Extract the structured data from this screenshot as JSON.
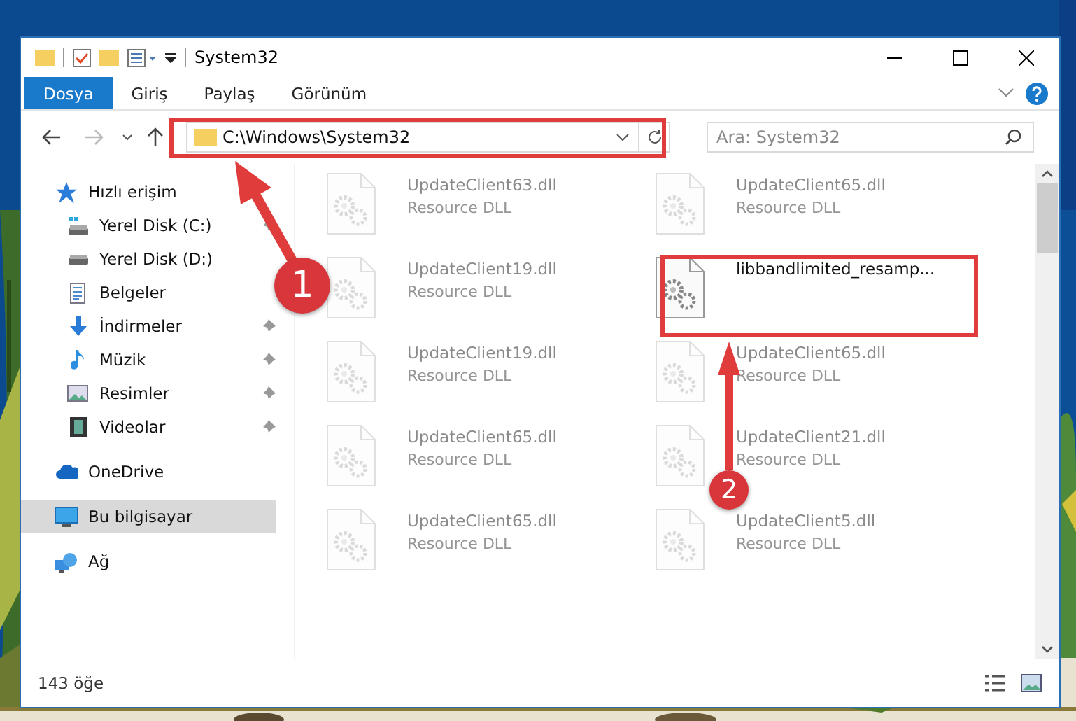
{
  "window": {
    "title": "System32"
  },
  "ribbon_tabs": [
    {
      "label": "Dosya",
      "kind": "file",
      "selected": false
    },
    {
      "label": "Giriş",
      "kind": "tab",
      "selected": false
    },
    {
      "label": "Paylaş",
      "kind": "tab",
      "selected": false
    },
    {
      "label": "Görünüm",
      "kind": "tab",
      "selected": false
    }
  ],
  "address_bar": {
    "value": "C:\\Windows\\System32"
  },
  "search": {
    "placeholder": "Ara: System32"
  },
  "sidebar": {
    "items": [
      {
        "label": "Hızlı erişim",
        "selected": false,
        "children": [
          {
            "label": "Yerel Disk (C:)",
            "pinned": true,
            "selected": false
          },
          {
            "label": "Yerel Disk (D:)",
            "pinned": false,
            "selected": false
          },
          {
            "label": "Belgeler",
            "pinned": false,
            "selected": false
          },
          {
            "label": "İndirmeler",
            "pinned": true,
            "selected": false
          },
          {
            "label": "Müzik",
            "pinned": true,
            "selected": false
          },
          {
            "label": "Resimler",
            "pinned": true,
            "selected": false
          },
          {
            "label": "Videolar",
            "pinned": true,
            "selected": false
          }
        ]
      },
      {
        "label": "OneDrive",
        "selected": false
      },
      {
        "label": "Bu bilgisayar",
        "selected": true
      },
      {
        "label": "Ağ",
        "selected": false
      }
    ]
  },
  "files": [
    {
      "name": "UpdateClient63.dll",
      "type": "Resource DLL",
      "dimmed": true
    },
    {
      "name": "UpdateClient65.dll",
      "type": "Resource DLL",
      "dimmed": true
    },
    {
      "name": "UpdateClient19.dll",
      "type": "Resource DLL",
      "dimmed": true
    },
    {
      "name": "libbandlimited_resamp...",
      "dimmed": false
    },
    {
      "name": "UpdateClient19.dll",
      "type": "Resource DLL",
      "dimmed": true
    },
    {
      "name": "UpdateClient65.dll",
      "type": "Resource DLL",
      "dimmed": true
    },
    {
      "name": "UpdateClient65.dll",
      "type": "Resource DLL",
      "dimmed": true
    },
    {
      "name": "UpdateClient21.dll",
      "type": "Resource DLL",
      "dimmed": true
    },
    {
      "name": "UpdateClient65.dll",
      "type": "Resource DLL",
      "dimmed": true
    },
    {
      "name": "UpdateClient5.dll",
      "type": "Resource DLL",
      "dimmed": true
    }
  ],
  "annotations": [
    {
      "label": "1"
    },
    {
      "label": "2"
    }
  ],
  "status_bar": {
    "item_count": "143 öğe"
  }
}
